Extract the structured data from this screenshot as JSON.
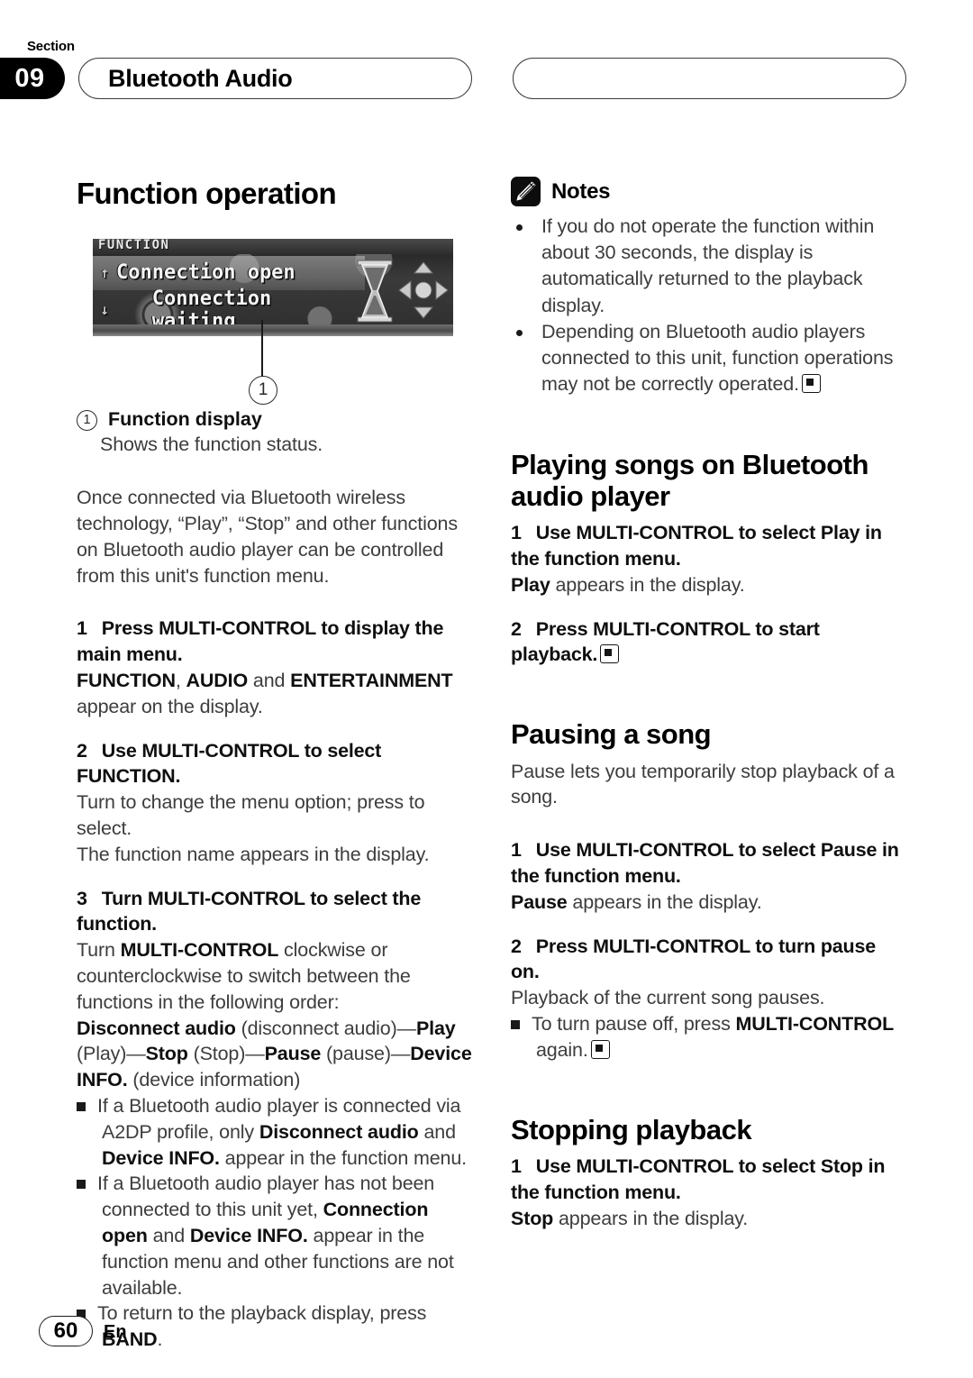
{
  "header": {
    "section_word": "Section",
    "section_number": "09",
    "chapter_title": "Bluetooth Audio"
  },
  "left_column": {
    "heading": "Function operation",
    "figure": {
      "lcd_header": "FUNCTION",
      "row1_text": "Connection open",
      "row2_text": "Connection waiting",
      "row1_arrow": "↑",
      "row2_arrow": "↓",
      "callout_number": "1",
      "hourglass_icon": "hourglass-icon",
      "dpad_icon": "dpad-icon"
    },
    "caption": {
      "number": "1",
      "label": "Function display",
      "description": "Shows the function status."
    },
    "intro_paragraph": "Once connected via Bluetooth wireless technology, “Play”, “Stop” and other functions on Bluetooth audio player can be controlled from this unit's function menu.",
    "step1": {
      "num": "1",
      "text": "Press MULTI-CONTROL to display the main menu.",
      "result_bold_1": "FUNCTION",
      "result_sep_1": ", ",
      "result_bold_2": "AUDIO",
      "result_sep_2": " and ",
      "result_bold_3": "ENTERTAINMENT",
      "result_tail": " appear on the display."
    },
    "step2": {
      "num": "2",
      "text": "Use MULTI-CONTROL to select FUNCTION.",
      "result_1": "Turn to change the menu option; press to select.",
      "result_2": "The function name appears in the display."
    },
    "step3": {
      "num": "3",
      "text": "Turn MULTI-CONTROL to select the function.",
      "body_pre": "Turn ",
      "body_bold": "MULTI-CONTROL",
      "body_post": " clockwise or counterclockwise to switch between the functions in the following order:",
      "order_sequence": [
        {
          "bold": "Disconnect audio",
          "plain": " (disconnect audio)—"
        },
        {
          "bold": "Play",
          "plain": " (Play)—"
        },
        {
          "bold": "Stop",
          "plain": " (Stop)—"
        },
        {
          "bold": "Pause",
          "plain": " (pause)—"
        },
        {
          "bold": "Device INFO.",
          "plain": " (device information)"
        }
      ],
      "notes": [
        {
          "pre": "If a Bluetooth audio player is connected via A2DP profile, only ",
          "bold1": "Disconnect audio",
          "mid": " and ",
          "bold2": "Device INFO.",
          "post": " appear in the function menu."
        },
        {
          "pre": "If a Bluetooth audio player has not been connected to this unit yet, ",
          "bold1": "Connection open",
          "mid": " and ",
          "bold2": "Device INFO.",
          "post": " appear in the function menu and other functions are not available."
        },
        {
          "pre": "To return to the playback display, press ",
          "bold1": "BAND",
          "mid": "",
          "bold2": "",
          "post": "."
        }
      ]
    }
  },
  "right_column": {
    "notes_block": {
      "icon": "pencil-note-icon",
      "title": "Notes",
      "items": [
        "If you do not operate the function within about 30 seconds, the display is automatically returned to the playback display.",
        "Depending on Bluetooth audio players connected to this unit, function operations may not be correctly operated."
      ]
    },
    "playing": {
      "heading": "Playing songs on Bluetooth audio player",
      "step1": {
        "num": "1",
        "text": "Use MULTI-CONTROL to select Play in the function menu.",
        "result_bold": "Play",
        "result_tail": " appears in the display."
      },
      "step2": {
        "num": "2",
        "text": "Press MULTI-CONTROL to start playback."
      }
    },
    "pausing": {
      "heading": "Pausing a song",
      "intro": "Pause lets you temporarily stop playback of a song.",
      "step1": {
        "num": "1",
        "text": "Use MULTI-CONTROL to select Pause in the function menu.",
        "result_bold": "Pause",
        "result_tail": " appears in the display."
      },
      "step2": {
        "num": "2",
        "text": "Press MULTI-CONTROL to turn pause on.",
        "result": "Playback of the current song pauses.",
        "note_pre": "To turn pause off, press ",
        "note_bold": "MULTI-CONTROL",
        "note_post": " again."
      }
    },
    "stopping": {
      "heading": "Stopping playback",
      "step1": {
        "num": "1",
        "text": "Use MULTI-CONTROL to select Stop in the function menu.",
        "result_bold": "Stop",
        "result_tail": " appears in the display."
      }
    }
  },
  "footer": {
    "page_number": "60",
    "language": "En"
  }
}
